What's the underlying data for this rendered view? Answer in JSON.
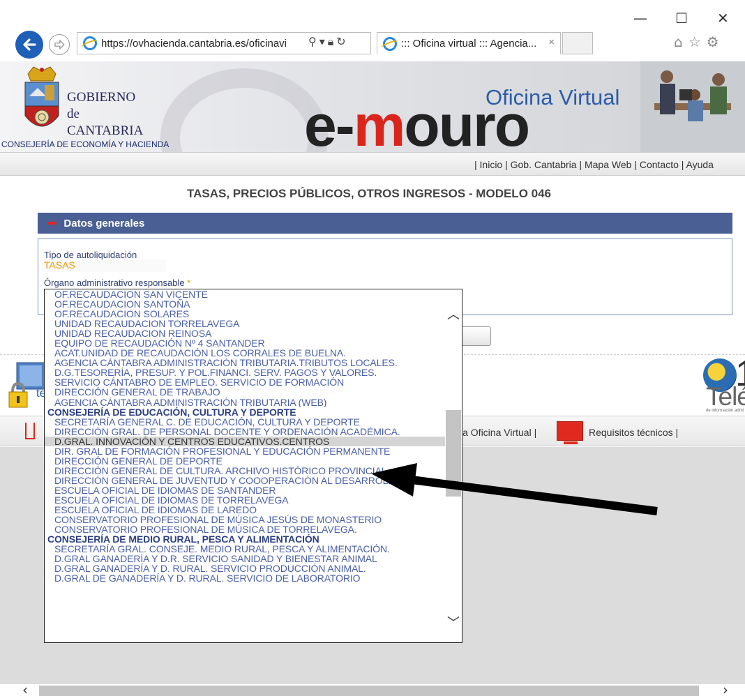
{
  "browser": {
    "url": "https://ovhacienda.cantabria.es/oficinavi",
    "tab_title": "::: Oficina virtual ::: Agencia...",
    "tab_close": "×",
    "minimize": "—",
    "maximize": "☐",
    "close": "✕"
  },
  "banner": {
    "gov_line1": "GOBIERNO",
    "gov_line2": "de",
    "gov_line3": "CANTABRIA",
    "consejeria": "CONSEJERÍA DE ECONOMÍA Y HACIENDA",
    "oficina_virtual": "Oficina Virtual",
    "logo_e": "e-",
    "logo_m": "m",
    "logo_ouro": "ouro"
  },
  "top_links": "| Inicio | Gob. Cantabria | Mapa Web | Contacto | Ayuda",
  "page_title": "TASAS, PRECIOS PÚBLICOS, OTROS INGRESOS - MODELO 046",
  "section": {
    "title": "Datos generales"
  },
  "form": {
    "tipo_label": "Tipo de autoliquidación",
    "tipo_value": "TASAS",
    "organo_label": "Órgano administrativo responsable",
    "required_mark": "*"
  },
  "footer": {
    "left_text": "te",
    "tel_one": "1",
    "tel_text": "Teléfo",
    "tel_small": "de información admi",
    "link_oficina": "la Oficina Virtual |",
    "link_requisitos": "Requisitos técnicos |"
  },
  "listbox": {
    "items": [
      {
        "text": "OF.RECAUDACION SAN VICENTE",
        "type": "item"
      },
      {
        "text": "OF.RECAUDACION SANTOÑA",
        "type": "item"
      },
      {
        "text": "OF.RECAUDACION SOLARES",
        "type": "item"
      },
      {
        "text": "UNIDAD RECAUDACION TORRELAVEGA",
        "type": "item"
      },
      {
        "text": "UNIDAD RECAUDACION REINOSA",
        "type": "item"
      },
      {
        "text": "EQUIPO DE RECAUDACIÓN Nº 4 SANTANDER",
        "type": "item"
      },
      {
        "text": "ACAT.UNIDAD DE RECAUDACIÓN LOS CORRALES DE BUELNA.",
        "type": "item"
      },
      {
        "text": "AGENCIA CÁNTABRA ADMINISTRACIÓN TRIBUTARIA.TRIBUTOS LOCALES.",
        "type": "item"
      },
      {
        "text": "D.G.TESORERÍA, PRESUP. Y POL.FINANCI. SERV. PAGOS Y VALORES.",
        "type": "item"
      },
      {
        "text": "SERVICIO CÁNTABRO DE EMPLEO. SERVICIO DE FORMACIÓN",
        "type": "item"
      },
      {
        "text": "DIRECCIÓN GENERAL DE TRABAJO",
        "type": "item"
      },
      {
        "text": "AGENCIA CÁNTABRA ADMINISTRACIÓN TRIBUTARIA (WEB)",
        "type": "item"
      },
      {
        "text": "CONSEJERÍA DE EDUCACIÓN, CULTURA Y DEPORTE",
        "type": "group"
      },
      {
        "text": "SECRETARÍA GENERAL C. DE EDUCACIÓN, CULTURA Y DEPORTE",
        "type": "item"
      },
      {
        "text": "DIRECCIÓN GRAL. DE PERSONAL DOCENTE Y ORDENACIÓN ACADÉMICA.",
        "type": "item"
      },
      {
        "text": "D.GRAL. INNOVACIÓN Y CENTROS EDUCATIVOS.CENTROS",
        "type": "item",
        "selected": true
      },
      {
        "text": "DIR. GRAL DE FORMACIÓN PROFESIONAL Y EDUCACIÓN PERMANENTE",
        "type": "item"
      },
      {
        "text": "DIRECCIÓN GENERAL DE DEPORTE",
        "type": "item"
      },
      {
        "text": "DIRECCIÓN GENERAL DE CULTURA. ARCHIVO HISTÓRICO PROVINCIAL",
        "type": "item"
      },
      {
        "text": "DIRECCIÓN GENERAL DE JUVENTUD Y COOOPERACIÓN AL DESARROLLO",
        "type": "item"
      },
      {
        "text": "ESCUELA OFICIAL DE IDIOMAS DE SANTANDER",
        "type": "item"
      },
      {
        "text": "ESCUELA OFICIAL DE IDIOMAS DE TORRELAVEGA",
        "type": "item"
      },
      {
        "text": "ESCUELA OFICIAL DE IDIOMAS DE LAREDO",
        "type": "item"
      },
      {
        "text": "CONSERVATORIO PROFESIONAL DE MÚSICA JESÚS DE MONASTERIO",
        "type": "item"
      },
      {
        "text": "CONSERVATORIO PROFESIONAL DE MÚSICA DE TORRELAVEGA.",
        "type": "item"
      },
      {
        "text": "CONSEJERÍA DE MEDIO RURAL, PESCA Y ALIMENTACIÓN",
        "type": "group"
      },
      {
        "text": "SECRETARÍA GRAL. CONSEJE. MEDIO RURAL, PESCA Y ALIMENTACIÓN.",
        "type": "item"
      },
      {
        "text": "D.GRAL GANADERÍA Y D.R. SERVICIO SANIDAD Y BIENESTAR ANIMAL",
        "type": "item"
      },
      {
        "text": "D.GRAL GANADERÍA Y D. RURAL. SERVICIO PRODUCCIÓN ANIMAL.",
        "type": "item"
      },
      {
        "text": "D.GRAL DE GANADERÍA Y D. RURAL. SERVICIO DE LABORATORIO",
        "type": "item"
      }
    ]
  },
  "colors": {
    "accent": "#4a5f94",
    "link": "#4a5fa8",
    "logo_red": "#d9261c",
    "tipo_value": "#e59a00"
  },
  "icons": [
    "back-arrow-icon",
    "forward-arrow-icon",
    "ie-icon",
    "search-icon",
    "lock-icon",
    "refresh-icon",
    "home-icon",
    "favorites-star-icon",
    "settings-gear-icon",
    "red-arrow-icon",
    "telephone-globe-icon",
    "monitor-icon"
  ]
}
